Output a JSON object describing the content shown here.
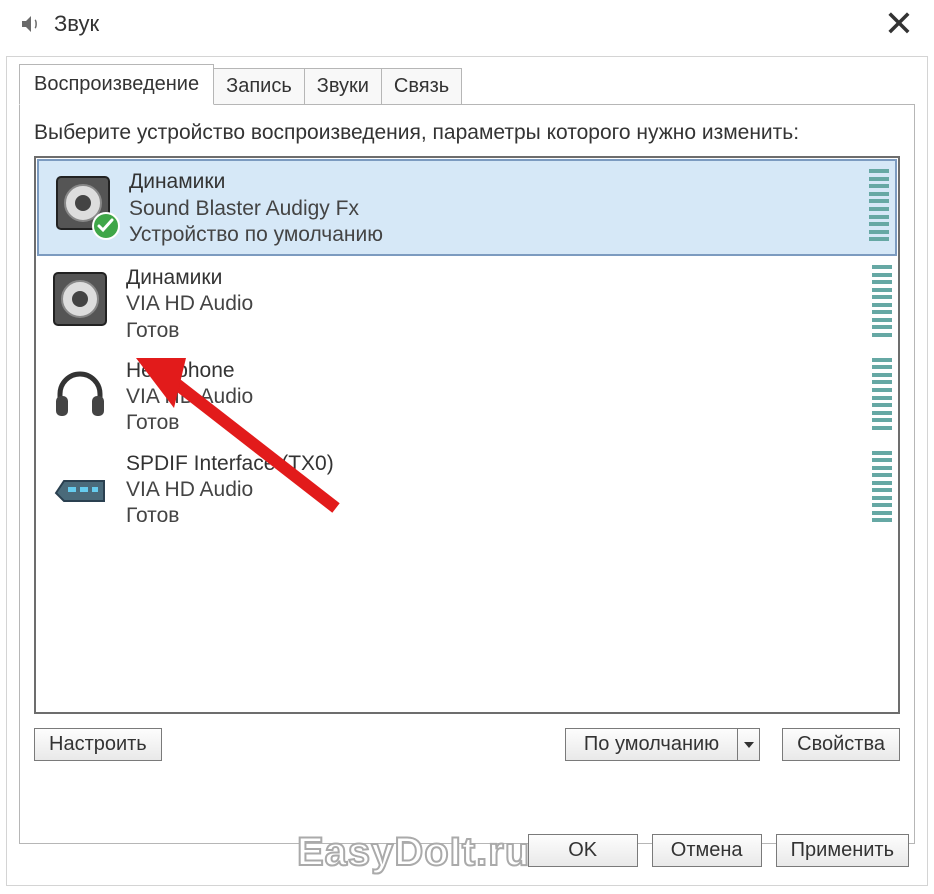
{
  "window": {
    "title": "Звук",
    "close": "✕"
  },
  "tabs": {
    "t0": "Воспроизведение",
    "t1": "Запись",
    "t2": "Звуки",
    "t3": "Связь"
  },
  "instruction": "Выберите устройство воспроизведения, параметры которого нужно изменить:",
  "devices": {
    "d0": {
      "name": "Динамики",
      "desc": "Sound Blaster Audigy Fx",
      "status": "Устройство по умолчанию"
    },
    "d1": {
      "name": "Динамики",
      "desc": "VIA HD Audio",
      "status": "Готов"
    },
    "d2": {
      "name": "Headphone",
      "desc": "VIA HD Audio",
      "status": "Готов"
    },
    "d3": {
      "name": "SPDIF Interface (TX0)",
      "desc": "VIA HD Audio",
      "status": "Готов"
    }
  },
  "buttons": {
    "configure": "Настроить",
    "set_default": "По умолчанию",
    "properties": "Свойства",
    "ok": "OK",
    "cancel": "Отмена",
    "apply": "Применить"
  },
  "watermark": "EasyDoIt.ru"
}
